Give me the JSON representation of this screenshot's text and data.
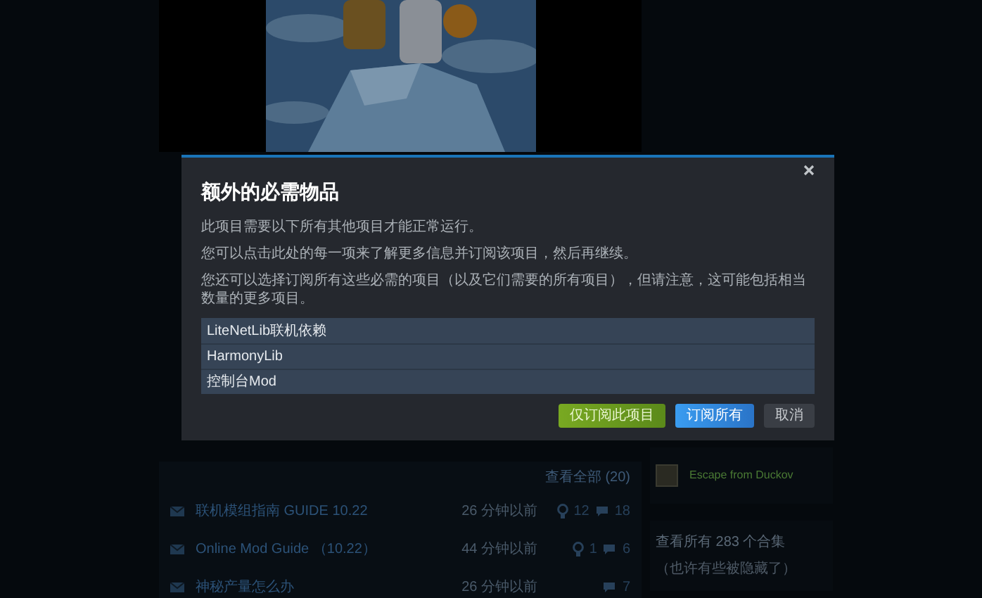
{
  "background": {
    "discussions_link": "查看全部 (20)",
    "discussions": [
      {
        "title": "联机模组指南 GUIDE 10.22",
        "time": "26 分钟以前",
        "awards": "12",
        "comments": "18"
      },
      {
        "title": "Online Mod Guide （10.22）",
        "time": "44 分钟以前",
        "awards": "1",
        "comments": "6"
      },
      {
        "title": "神秘产量怎么办",
        "time": "26 分钟以前",
        "comments": "7"
      }
    ],
    "game": "Escape from Duckov",
    "collections": {
      "text": "查看所有 283 个合集",
      "note": "（也许有些被隐藏了）"
    }
  },
  "dialog": {
    "title": "额外的必需物品",
    "paragraphs": [
      "此项目需要以下所有其他项目才能正常运行。",
      "您可以点击此处的每一项来了解更多信息并订阅该项目，然后再继续。",
      "您还可以选择订阅所有这些必需的项目（以及它们需要的所有项目），但请注意，这可能包括相当数量的更多项目。"
    ],
    "items": [
      "LiteNetLib联机依赖",
      "HarmonyLib",
      "控制台Mod"
    ],
    "buttons": [
      {
        "label": "仅订阅此项目",
        "kind": "primary"
      },
      {
        "label": "订阅所有",
        "kind": "secondary"
      },
      {
        "label": "取消",
        "kind": "cancel"
      }
    ]
  }
}
